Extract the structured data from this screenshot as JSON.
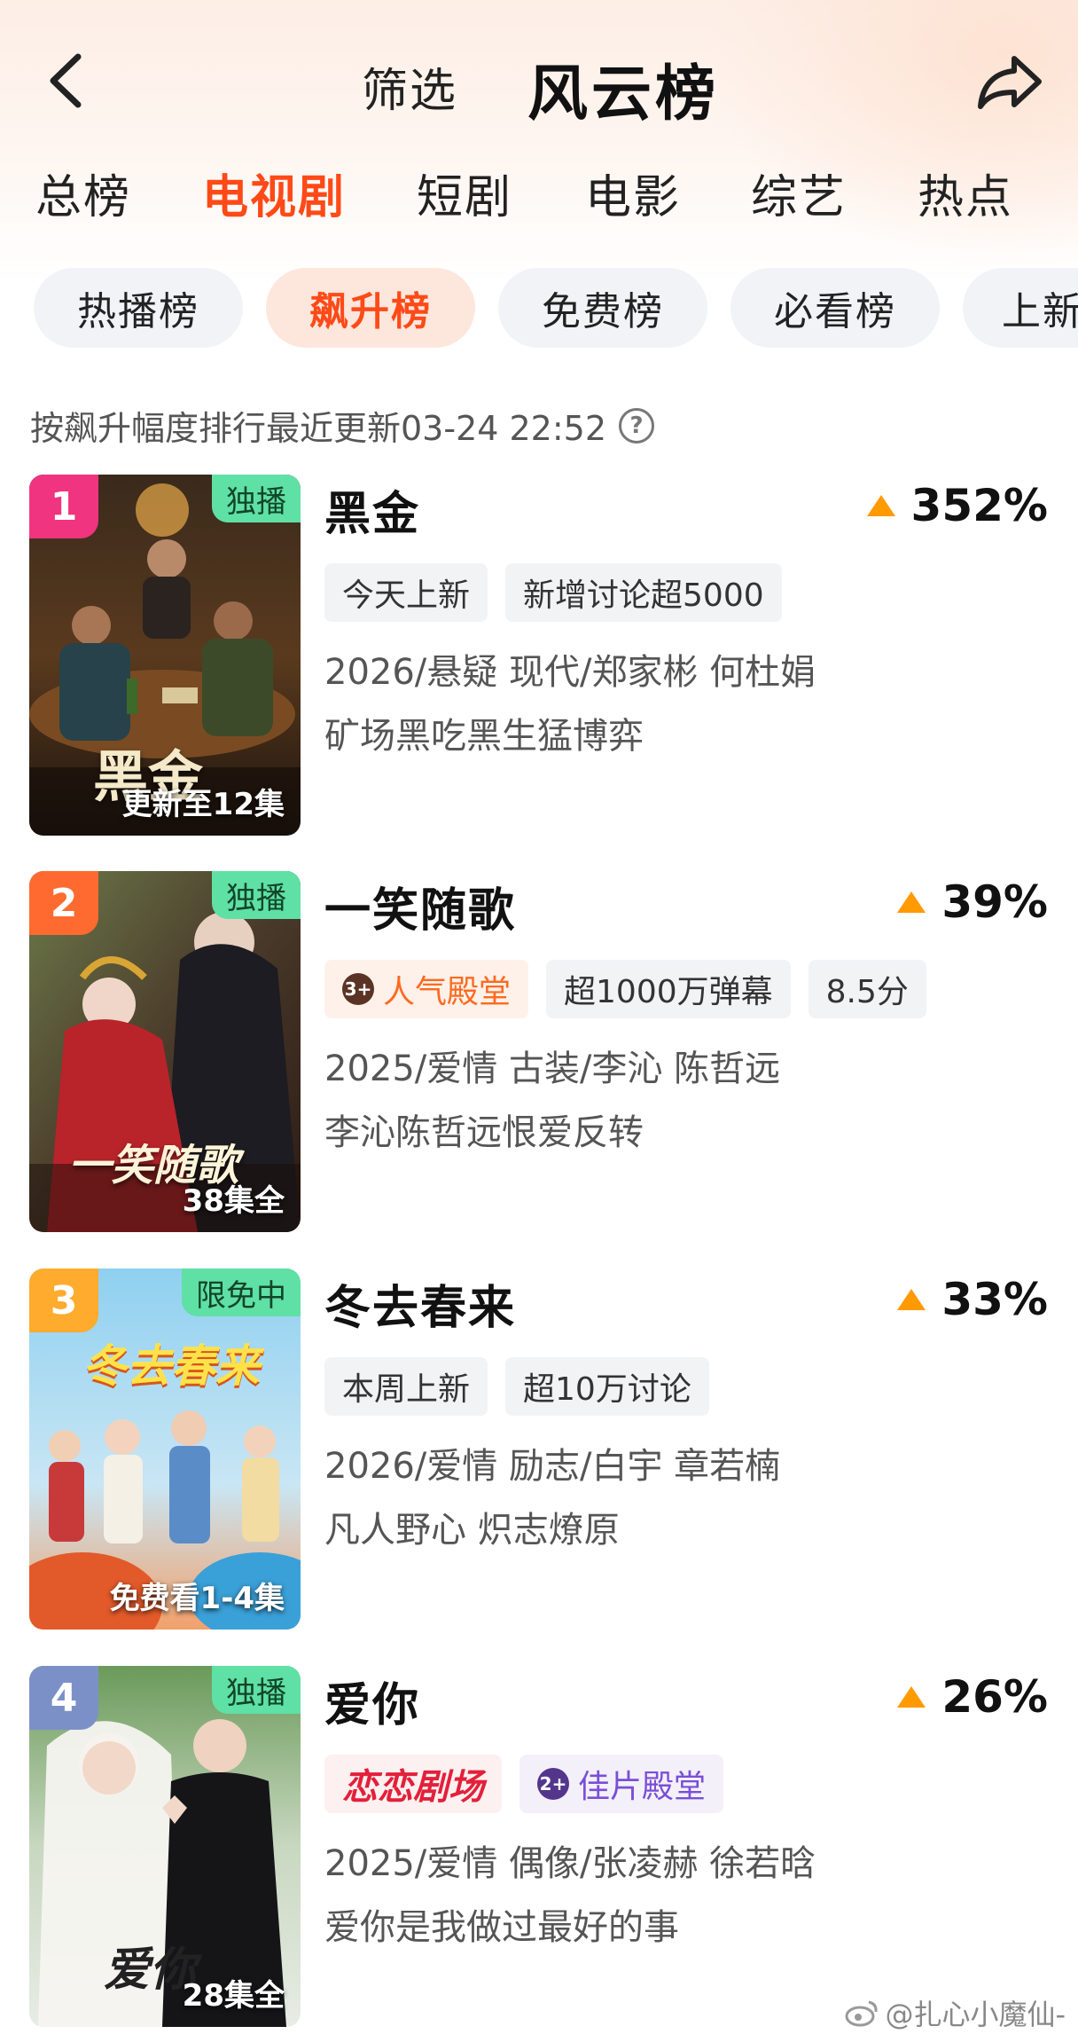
{
  "header": {
    "filter_label": "筛选",
    "title": "风云榜"
  },
  "category_tabs": [
    {
      "label": "总榜",
      "active": false
    },
    {
      "label": "电视剧",
      "active": true
    },
    {
      "label": "短剧",
      "active": false
    },
    {
      "label": "电影",
      "active": false
    },
    {
      "label": "综艺",
      "active": false
    },
    {
      "label": "热点",
      "active": false
    }
  ],
  "chips": [
    {
      "label": "热播榜",
      "active": false
    },
    {
      "label": "飙升榜",
      "active": true
    },
    {
      "label": "免费榜",
      "active": false
    },
    {
      "label": "必看榜",
      "active": false
    },
    {
      "label": "上新",
      "active": false
    }
  ],
  "update_text": "按飙升幅度排行最近更新03-24 22:52",
  "items": [
    {
      "rank": "1",
      "tag": "独播",
      "poster_text": "黑金",
      "episode": "更新至12集",
      "title": "黑金",
      "trend": "352%",
      "badges": [
        {
          "label": "今天上新",
          "style": "plain"
        },
        {
          "label": "新增讨论超5000",
          "style": "plain"
        }
      ],
      "meta": "2026/悬疑 现代/郑家彬 何杜娟",
      "slogan": "矿场黑吃黑生猛博弈"
    },
    {
      "rank": "2",
      "tag": "独播",
      "poster_text": "一笑随歌",
      "episode": "38集全",
      "title": "一笑随歌",
      "trend": "39%",
      "badges": [
        {
          "label": "人气殿堂",
          "style": "hot",
          "icon_text": "3+"
        },
        {
          "label": "超1000万弹幕",
          "style": "plain"
        },
        {
          "label": "8.5分",
          "style": "plain"
        }
      ],
      "meta": "2025/爱情 古装/李沁 陈哲远",
      "slogan": "李沁陈哲远恨爱反转"
    },
    {
      "rank": "3",
      "tag": "限免中",
      "poster_text": "冬去春来",
      "episode": "免费看1-4集",
      "title": "冬去春来",
      "trend": "33%",
      "badges": [
        {
          "label": "本周上新",
          "style": "plain"
        },
        {
          "label": "超10万讨论",
          "style": "plain"
        }
      ],
      "meta": "2026/爱情 励志/白宇 章若楠",
      "slogan": "凡人野心 炽志燎原"
    },
    {
      "rank": "4",
      "tag": "独播",
      "poster_text": "爱你",
      "episode": "28集全",
      "title": "爱你",
      "trend": "26%",
      "badges": [
        {
          "label": "恋恋剧场",
          "style": "red-logo"
        },
        {
          "label": "佳片殿堂",
          "style": "purple",
          "icon_text": "2+"
        }
      ],
      "meta": "2025/爱情 偶像/张凌赫 徐若晗",
      "slogan": "爱你是我做过最好的事"
    }
  ],
  "watermark": "@扎心小魔仙-",
  "colors": {
    "accent": "#ff4a18",
    "rank1": "#f0347f",
    "rank2": "#ff6a30",
    "rank3": "#ffab2e",
    "rank4": "#7c90c8",
    "trend_arrow": "#ff9a00",
    "tag_green": "#5fe0a5"
  }
}
